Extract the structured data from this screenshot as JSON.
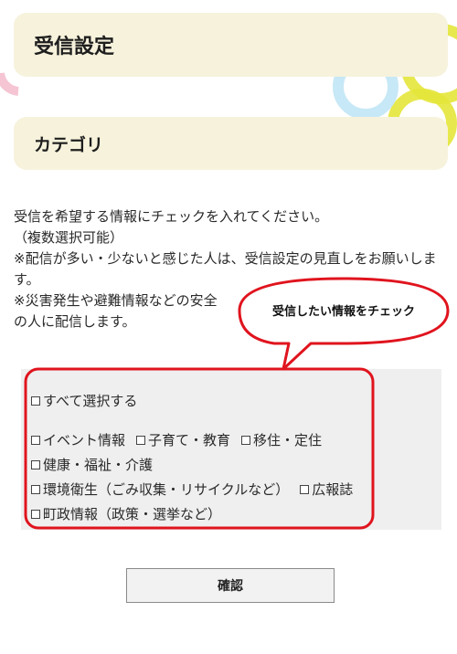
{
  "title": "受信設定",
  "category_heading": "カテゴリ",
  "instructions": {
    "line1": "受信を希望する情報にチェックを入れてください。",
    "line2": "（複数選択可能）",
    "line3": "※配信が多い・少ないと感じた人は、受信設定の見直しをお願いします。",
    "line4a": "※災害発生や避難情報などの安全",
    "line5a": "の人に配信します。"
  },
  "callout": "受信したい情報をチェック",
  "checkboxes": {
    "select_all": "すべて選択する",
    "event": "イベント情報",
    "childcare": "子育て・教育",
    "migration": "移住・定住",
    "health": "健康・福祉・介護",
    "environment": "環境衛生（ごみ収集・リサイクルなど）",
    "pr_magazine": "広報誌",
    "town_admin": "町政情報（政策・選挙など）"
  },
  "confirm_button": "確認",
  "colors": {
    "panel_bg": "#f6f2dc",
    "highlight_red": "#e0141e",
    "check_area_bg": "#efefef"
  }
}
